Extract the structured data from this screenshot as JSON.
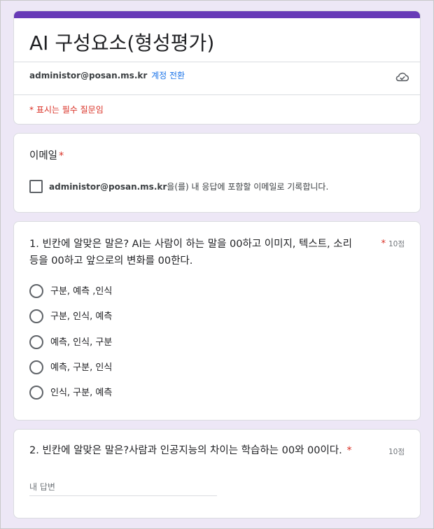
{
  "form": {
    "title": "AI 구성요소(형성평가)",
    "account_email": "administor@posan.ms.kr",
    "switch_account": "계정 전환",
    "required_note": "* 표시는 필수 질문임"
  },
  "email_question": {
    "title": "이메일",
    "required_star": "*",
    "checkbox_email": "administor@posan.ms.kr",
    "checkbox_text": "을(를) 내 응답에 포함할 이메일로 기록합니다."
  },
  "questions": [
    {
      "title_line1": "1. 빈칸에 알맞은 말은? AI는 사람이 하는 말을 00하고  이미지, 텍스트, 소리",
      "title_line2": "등을 00하고 앞으로의 변화를 00한다.",
      "required_star": "*",
      "points": "10점",
      "options": [
        "구분, 예측 ,인식",
        "구분, 인식, 예측",
        "예측, 인식, 구분",
        "예측, 구분, 인식",
        "인식, 구분, 예측"
      ]
    },
    {
      "title": "2. 빈칸에 알맞은 말은?사람과 인공지능의 차이는 학습하는 00와 00이다.",
      "required_star": "*",
      "points": "10점",
      "placeholder": "내 답변"
    }
  ],
  "colors": {
    "accent": "#673ab7",
    "background": "#ede7f6",
    "required": "#d93025",
    "link": "#1a73e8"
  },
  "icons": {
    "cloud": "cloud-done-icon"
  }
}
